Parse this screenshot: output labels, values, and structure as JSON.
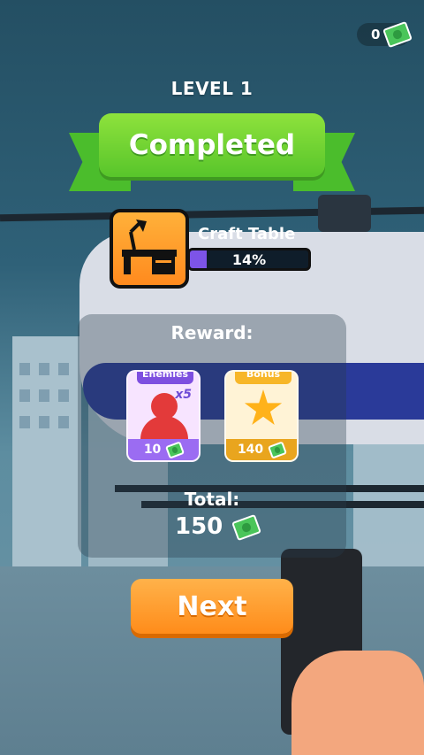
{
  "hud": {
    "money": "0"
  },
  "level": {
    "title": "LEVEL 1",
    "status": "Completed"
  },
  "unlock": {
    "name": "Craft Table",
    "progress_text": "14%",
    "progress_fraction": 0.14
  },
  "reward": {
    "label": "Reward:",
    "cards": [
      {
        "tag": "Enemies",
        "multiplier": "x5",
        "amount": "10"
      },
      {
        "tag": "Bonus",
        "amount": "140"
      }
    ]
  },
  "total": {
    "label": "Total:",
    "value": "150"
  },
  "actions": {
    "next_label": "Next"
  },
  "colors": {
    "accent_green": "#58c52b",
    "button_orange": "#ff8c1a",
    "progress_purple": "#7d54e8"
  }
}
